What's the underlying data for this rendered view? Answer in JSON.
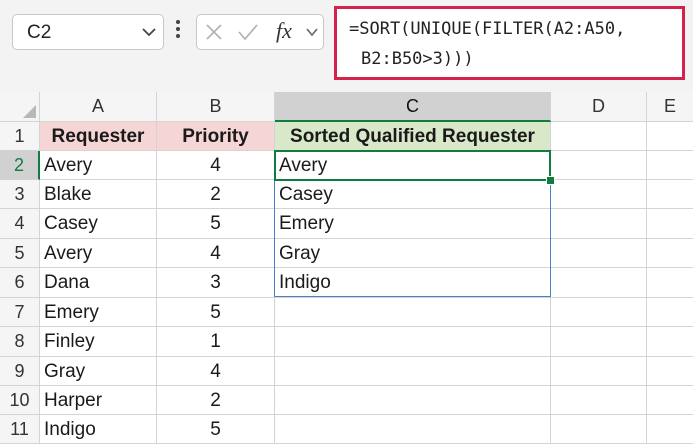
{
  "formula_bar": {
    "name_box": "C2",
    "fx_label": "fx",
    "formula_line1": "=SORT(UNIQUE(FILTER(A2:A50,",
    "formula_line2": "B2:B50>3)))"
  },
  "columns": [
    "A",
    "B",
    "C",
    "D",
    "E"
  ],
  "row_numbers": [
    "1",
    "2",
    "3",
    "4",
    "5",
    "6",
    "7",
    "8",
    "9",
    "10",
    "11"
  ],
  "headers": {
    "a": "Requester",
    "b": "Priority",
    "c": "Sorted Qualified Requester"
  },
  "requesters": [
    "Avery",
    "Blake",
    "Casey",
    "Avery",
    "Dana",
    "Emery",
    "Finley",
    "Gray",
    "Harper",
    "Indigo"
  ],
  "priorities": [
    "4",
    "2",
    "5",
    "4",
    "3",
    "5",
    "1",
    "4",
    "2",
    "5"
  ],
  "sorted": [
    "Avery",
    "Casey",
    "Emery",
    "Gray",
    "Indigo"
  ],
  "selection": {
    "active_cell": "C2",
    "active_column": "C",
    "active_row": "2"
  },
  "colors": {
    "requester_header_bg": "#f5d5d5",
    "result_header_bg": "#d9e8c8",
    "selection_border": "#107c41",
    "spill_border": "#4a80c8",
    "formula_highlight": "#d3224b"
  }
}
